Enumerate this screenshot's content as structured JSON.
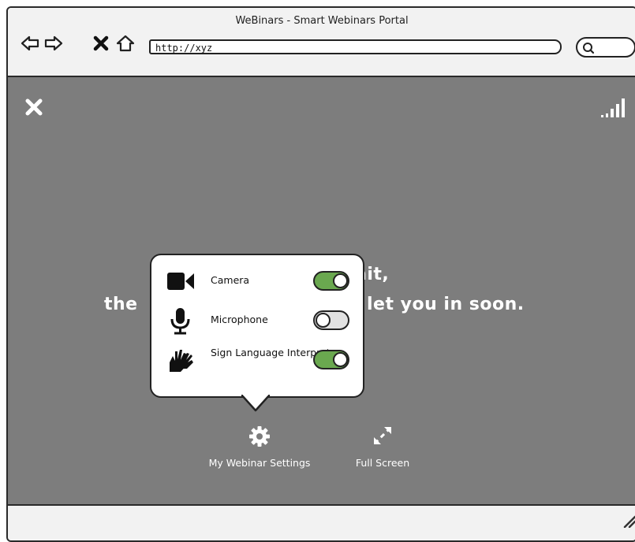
{
  "browser": {
    "title": "WeBinars - Smart Webinars Portal",
    "url": "http://xyz",
    "icons": [
      "back-arrow-icon",
      "forward-arrow-icon",
      "stop-icon",
      "home-icon",
      "search-icon"
    ]
  },
  "waiting": {
    "line1": "ait,",
    "line2_left": "the",
    "line2_right": "let you in soon."
  },
  "settings_popover": {
    "rows": [
      {
        "label": "Camera",
        "icon": "video-camera-icon",
        "enabled": true
      },
      {
        "label": "Microphone",
        "icon": "microphone-icon",
        "enabled": false
      },
      {
        "label": "Sign Language Interpreter",
        "icon": "sign-language-icon",
        "enabled": true
      }
    ]
  },
  "bottom_bar": {
    "settings_label": "My Webinar Settings",
    "fullscreen_label": "Full Screen"
  },
  "colors": {
    "content_bg": "#7d7d7d",
    "toggle_on": "#6aa84f",
    "toggle_off": "#e2e2e2"
  }
}
